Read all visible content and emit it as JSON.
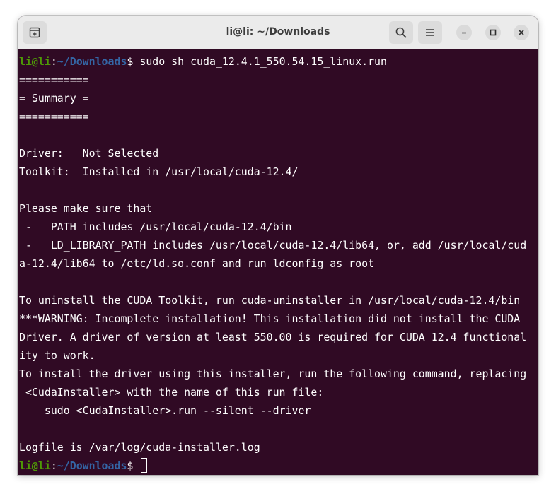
{
  "window": {
    "title": "li@li: ~/Downloads"
  },
  "icons": {
    "new_tab": "new-tab-icon",
    "search": "search-icon",
    "menu": "hamburger-menu-icon",
    "minimize": "minimize-icon",
    "maximize": "maximize-icon",
    "close": "close-icon"
  },
  "colors": {
    "terminal_background": "#300a24",
    "prompt_user": "#4e9a06",
    "prompt_path": "#3465a4",
    "text": "#ffffff",
    "titlebar": "#ebebeb"
  },
  "prompt": {
    "user_host": "li@li",
    "separator": ":",
    "path": "~/Downloads",
    "symbol": "$ "
  },
  "command": "sudo sh cuda_12.4.1_550.54.15_linux.run",
  "output_lines": [
    "===========",
    "= Summary =",
    "===========",
    "",
    "Driver:   Not Selected",
    "Toolkit:  Installed in /usr/local/cuda-12.4/",
    "",
    "Please make sure that",
    " -   PATH includes /usr/local/cuda-12.4/bin",
    " -   LD_LIBRARY_PATH includes /usr/local/cuda-12.4/lib64, or, add /usr/local/cud",
    "a-12.4/lib64 to /etc/ld.so.conf and run ldconfig as root",
    "",
    "To uninstall the CUDA Toolkit, run cuda-uninstaller in /usr/local/cuda-12.4/bin",
    "***WARNING: Incomplete installation! This installation did not install the CUDA",
    "Driver. A driver of version at least 550.00 is required for CUDA 12.4 functional",
    "ity to work.",
    "To install the driver using this installer, run the following command, replacing",
    " <CudaInstaller> with the name of this run file:",
    "    sudo <CudaInstaller>.run --silent --driver",
    "",
    "Logfile is /var/log/cuda-installer.log"
  ]
}
